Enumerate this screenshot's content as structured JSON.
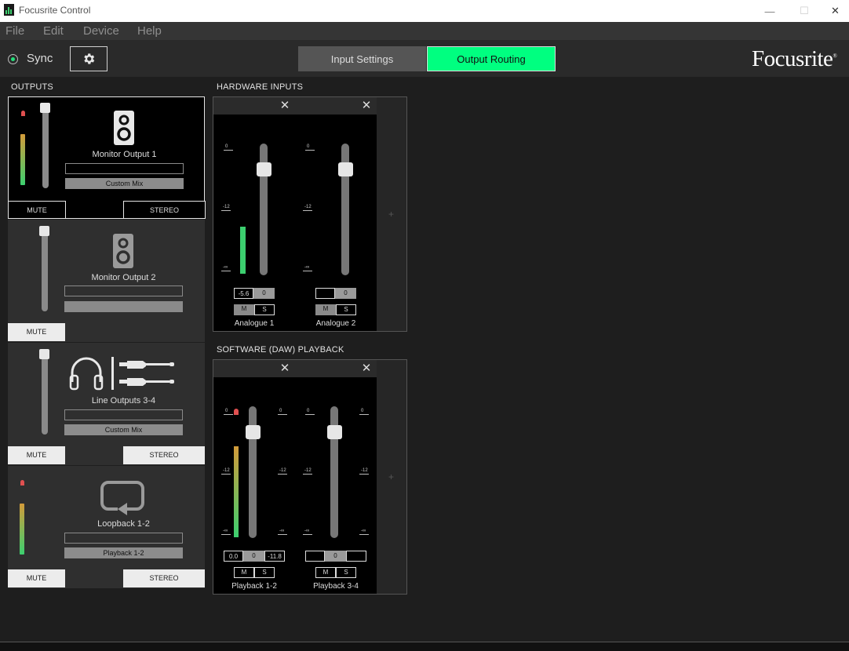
{
  "window": {
    "title": "Focusrite Control",
    "minimize": "—",
    "maximize": "☐",
    "close": "✕"
  },
  "menu": {
    "items": [
      "File",
      "Edit",
      "Device",
      "Help"
    ]
  },
  "toolbar": {
    "sync_label": "Sync",
    "tabs": [
      "Input Settings",
      "Output Routing"
    ],
    "active_tab": "Output Routing",
    "brand": "Focusrite",
    "trademark": "®"
  },
  "colors": {
    "accent": "#00ff80",
    "meter_green": "#3ccf6f",
    "meter_orange": "#d39b3a",
    "clip_red": "#e05050"
  },
  "outputs": {
    "title": "OUTPUTS",
    "items": [
      {
        "name": "Monitor Output 1",
        "source": "Custom Mix",
        "mute": "MUTE",
        "stereo": "STEREO",
        "icon": "speaker-icon",
        "meter_level": 0.68
      },
      {
        "name": "Monitor Output 2",
        "source": "",
        "mute": "MUTE",
        "stereo": "",
        "icon": "speaker-icon"
      },
      {
        "name": "Line Outputs 3-4",
        "source": "Custom Mix",
        "mute": "MUTE",
        "stereo": "STEREO",
        "icon": "headphones-cable-icon"
      },
      {
        "name": "Loopback 1-2",
        "source": "Playback 1-2",
        "mute": "MUTE",
        "stereo": "STEREO",
        "icon": "loopback-icon",
        "meter_level": 0.6
      }
    ]
  },
  "hardware_inputs": {
    "title": "HARDWARE INPUTS",
    "scale": [
      "0",
      "-12",
      "-∞"
    ],
    "plus": "+",
    "close": "✕",
    "channels": [
      {
        "name": "Analogue 1",
        "gain": "-5.6",
        "pan": "0",
        "m": "M",
        "s": "S",
        "meter_level": 0.36
      },
      {
        "name": "Analogue 2",
        "gain": "",
        "pan": "0",
        "m": "M",
        "s": "S",
        "meter_level": 0
      }
    ]
  },
  "software_playback": {
    "title": "SOFTWARE (DAW) PLAYBACK",
    "scale": [
      "0",
      "-12",
      "-∞"
    ],
    "plus": "+",
    "close": "✕",
    "channels": [
      {
        "name": "Playback 1-2",
        "gain": "0.0",
        "pan": "0",
        "right": "-11.8",
        "m": "M",
        "s": "S",
        "meter_level": 0.69
      },
      {
        "name": "Playback 3-4",
        "gain": "",
        "pan": "0",
        "right": "",
        "m": "M",
        "s": "S",
        "meter_level": 0
      }
    ]
  }
}
